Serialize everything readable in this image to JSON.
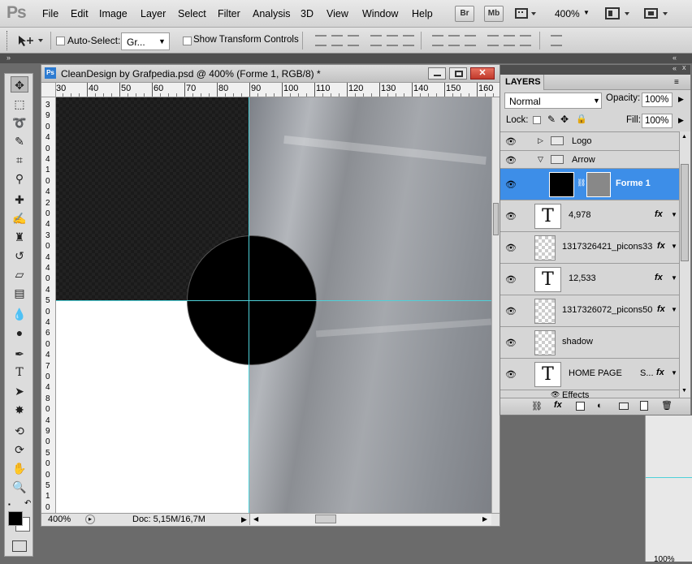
{
  "app": {
    "logo": "Ps"
  },
  "menu": [
    "File",
    "Edit",
    "Image",
    "Layer",
    "Select",
    "Filter",
    "Analysis",
    "3D",
    "View",
    "Window",
    "Help"
  ],
  "appbar": {
    "bridge": "Br",
    "minibridge": "Mb",
    "zoom": "400%"
  },
  "options": {
    "auto_select_label": "Auto-Select:",
    "auto_select_value": "Gr...",
    "transform_label": "Show Transform Controls"
  },
  "document": {
    "title": "CleanDesign by Grafpedia.psd @ 400% (Forme 1, RGB/8) *",
    "ruler_top": [
      "30",
      "40",
      "50",
      "60",
      "70",
      "80",
      "90",
      "100",
      "110",
      "120",
      "130",
      "140",
      "150",
      "160"
    ],
    "ruler_left": [
      "3",
      "9",
      "0",
      "4",
      "0",
      "4",
      "1",
      "0",
      "4",
      "2",
      "0",
      "4",
      "3",
      "0",
      "4",
      "4",
      "0",
      "4",
      "5",
      "0",
      "4",
      "6",
      "0",
      "4",
      "7",
      "0",
      "4",
      "8",
      "0",
      "4",
      "9",
      "0",
      "5",
      "0",
      "0",
      "5",
      "1",
      "0"
    ],
    "status_zoom": "400%",
    "status_doc": "Doc: 5,15M/16,7M"
  },
  "layers": {
    "panel_title": "LAYERS",
    "blend_mode": "Normal",
    "opacity_label": "Opacity:",
    "opacity_value": "100%",
    "lock_label": "Lock:",
    "fill_label": "Fill:",
    "fill_value": "100%",
    "groups": [
      {
        "name": "Logo"
      },
      {
        "name": "Arrow"
      }
    ],
    "items": [
      {
        "name": "Forme 1",
        "type": "shape",
        "selected": true
      },
      {
        "name": "4,978",
        "type": "text",
        "fx": "fx"
      },
      {
        "name": "1317326421_picons33",
        "type": "smart",
        "fx": "fx"
      },
      {
        "name": "12,533",
        "type": "text",
        "fx": "fx"
      },
      {
        "name": "1317326072_picons50",
        "type": "smart",
        "fx": "fx"
      },
      {
        "name": "shadow",
        "type": "raster"
      },
      {
        "name": "HOME PAGE",
        "type": "text",
        "suffix": "S...",
        "fx": "fx"
      }
    ],
    "effects_label": "Effects"
  },
  "right_edge": {
    "zoom": "100%"
  },
  "colors": {
    "selected_layer": "#3d8ee8",
    "guide": "#4fd1d9",
    "panel_strip": "#4e4e4e"
  }
}
